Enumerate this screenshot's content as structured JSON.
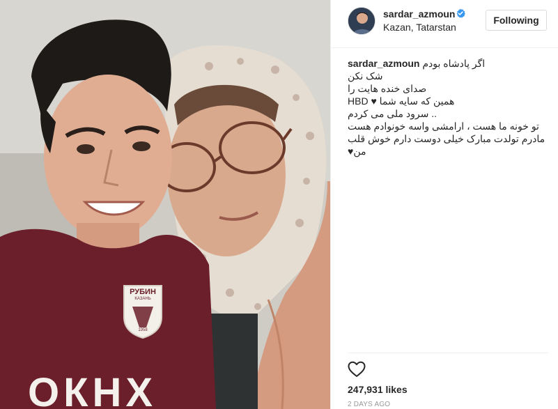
{
  "post": {
    "image_description": "",
    "username": "sardar_azmoun",
    "verified_icon": "verified-badge-icon",
    "location": "Kazan, Tatarstan",
    "follow_label": "Following",
    "caption": {
      "username": "sardar_azmoun",
      "first_line": "اگر پادشاه بودم",
      "lines": [
        "شک نکن",
        "صدای خنده هایت را",
        "همین که سایه شما ♥ HBD",
        ".. سرود ملی می کردم",
        "تو خونه ما هست ، ارامشی واسه خونوادم هست",
        "مادرم تولدت مبارک خیلی دوست دارم خوش قلب",
        "من♥"
      ]
    },
    "like_icon": "heart-outline-icon",
    "likes": "247,931 likes",
    "timestamp": "2 DAYS AGO",
    "colors": {
      "accent_verified": "#3897f0",
      "text": "#262626",
      "muted": "#999999",
      "border": "#dbdbdb",
      "jersey": "#6b1f2a"
    },
    "jersey_text": {
      "crest_name": "РУБИН",
      "crest_city": "КАЗАНЬ",
      "crest_year": "1958",
      "sponsor": "ОКНХ"
    }
  }
}
